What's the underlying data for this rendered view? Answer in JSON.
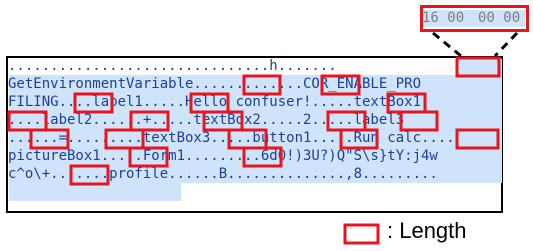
{
  "hex_zoom": {
    "part1": "16 00",
    "part2": "00 00"
  },
  "dump_lines": [
    "...............................h.......",
    "GetEnvironmentVariable.............COR_ENABLE_PRO",
    "FILING....label1.....Hello confuser!.....textBox1",
    "....label2......+.....textBox2.....2.....label3",
    "......=.........textBox3.....button1.....Run calc....",
    "pictureBox1.....Form1.........6d0!)3U?)Q\"S\\s}tY:j4w",
    "c^o\\+.......profile......B..............,8........."
  ],
  "legend": {
    "label": ": Length"
  },
  "colors": {
    "marker_red": "#e8141e",
    "selection_blue": "#cfe3fa",
    "dump_text": "#1c3f9a",
    "hex_gray": "#7f7f7f"
  }
}
